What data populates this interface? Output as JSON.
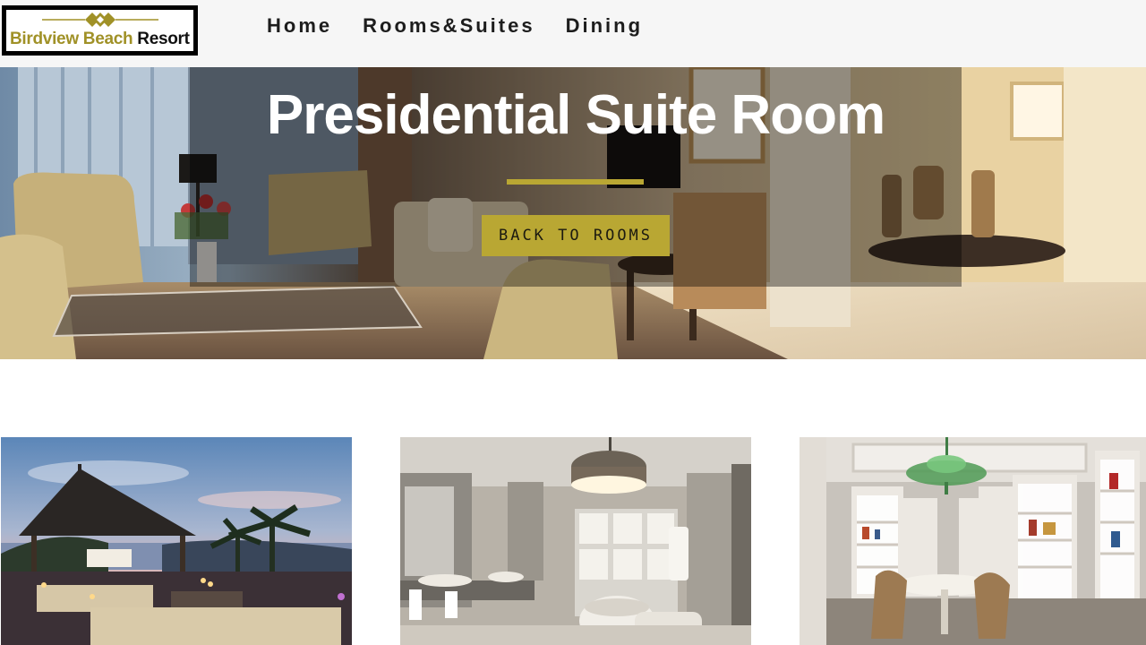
{
  "brand": {
    "name_part1": "Birdview Beach",
    "name_part2": "Resort",
    "logo_icon": "diamond-emblem-icon",
    "accent_color": "#b9a733"
  },
  "nav": {
    "items": [
      {
        "label": "Home"
      },
      {
        "label": "Rooms&Suites"
      },
      {
        "label": "Dining"
      }
    ]
  },
  "hero": {
    "title": "Presidential Suite Room",
    "button_label": "BACK TO ROOMS"
  },
  "gallery": {
    "images": [
      {
        "subject": "beachfront-pavilion-at-dusk"
      },
      {
        "subject": "marble-bathroom-with-freestanding-tub"
      },
      {
        "subject": "dining-room-with-display-shelves"
      }
    ]
  }
}
